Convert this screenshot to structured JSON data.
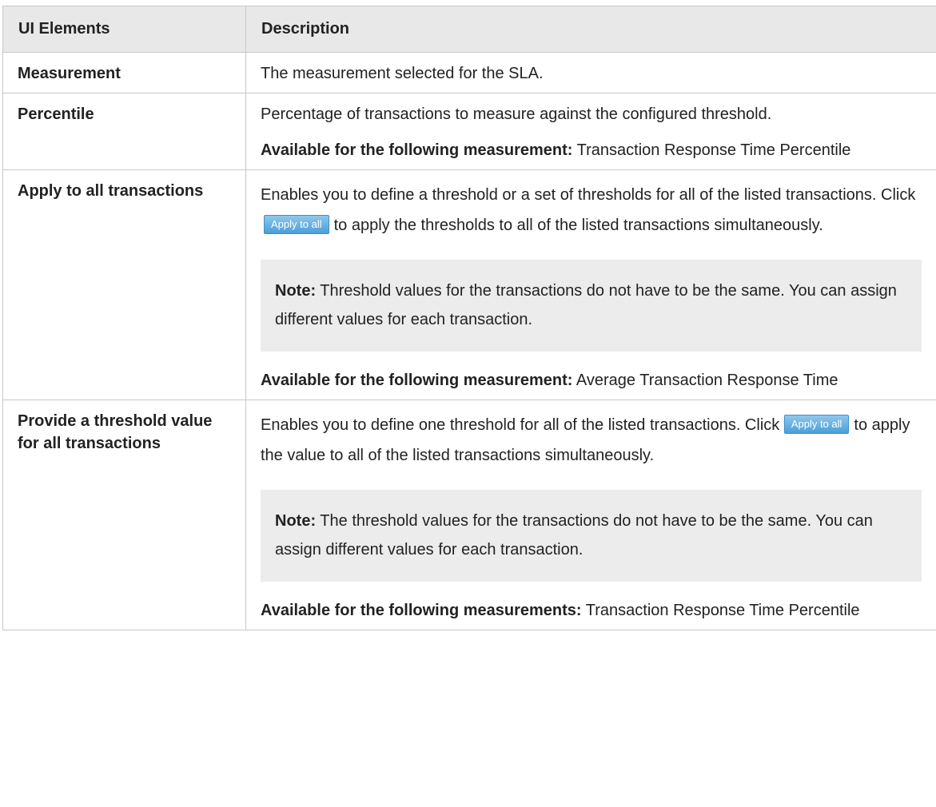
{
  "table": {
    "headers": [
      "UI Elements",
      "Description"
    ],
    "rows": [
      {
        "element": "Measurement",
        "description": "The measurement selected for the SLA."
      },
      {
        "element": "Percentile",
        "description": "Percentage of transactions to measure against the configured threshold.",
        "avail_label": "Available for the following measurement:",
        "avail_text": " Transaction Response Time Percentile"
      },
      {
        "element": "Apply to all transactions",
        "description_before": "Enables you to define a threshold or a set of thresholds for all of the listed transactions. Click",
        "button_label": "Apply to all",
        "description_after": "to apply the thresholds to all of the listed transactions simultaneously.",
        "note_label": "Note:",
        "note_text": " Threshold values for the transactions do not have to be the same. You can assign different values for each transaction.",
        "avail_label": "Available for the following measurement:",
        "avail_text": " Average Transaction Response Time"
      },
      {
        "element": "Provide a threshold value for all transactions",
        "description_before": "Enables you to define one threshold for all of the listed transactions. Click",
        "button_label": "Apply to all",
        "description_after": "to apply the value to all of the listed transactions simultaneously.",
        "note_label": "Note:",
        "note_text": " The threshold values for the transactions do not have to be the same. You can assign different values for each transaction.",
        "avail_label": "Available for the following measurements:",
        "avail_text": " Transaction Response Time Percentile"
      }
    ]
  },
  "colors": {
    "header_bg": "#e8e8e8",
    "border": "#c8c8c8",
    "note_bg": "#ececec",
    "button_bg": "#4a9fd8"
  }
}
